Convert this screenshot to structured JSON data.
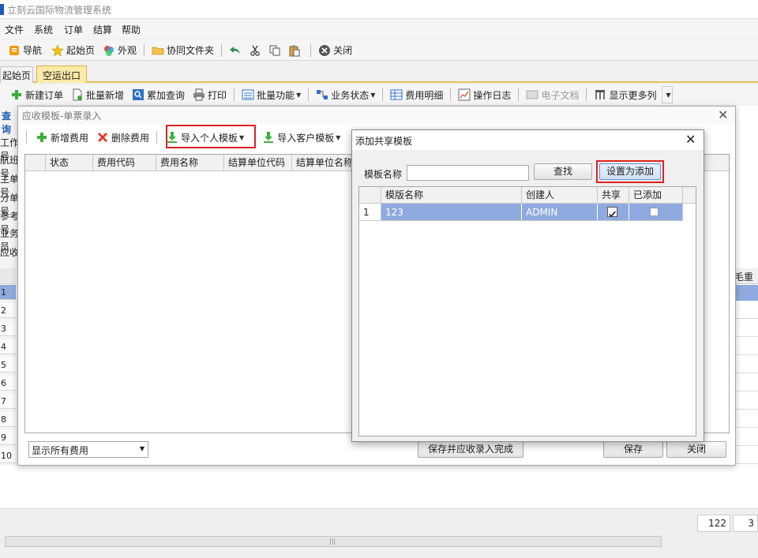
{
  "app": {
    "title": "立刻云国际物流管理系统"
  },
  "menubar": [
    "文件",
    "系统",
    "订单",
    "结算",
    "帮助"
  ],
  "main_toolbar": {
    "nav": "导航",
    "home": "起始页",
    "appearance": "外观",
    "shared_folder": "协同文件夹",
    "close": "关闭"
  },
  "doc_tabs": [
    "起始页",
    "空运出口"
  ],
  "order_toolbar": {
    "new_order": "新建订单",
    "batch_new": "批量新增",
    "cumulative_query": "累加查询",
    "print": "打印",
    "batch_func": "批量功能",
    "business_status": "业务状态",
    "fee_detail": "费用明细",
    "op_log": "操作日志",
    "e_docs": "电子文档",
    "show_more": "显示更多列"
  },
  "left_labels": [
    "查询",
    "工作号",
    "航班号",
    "主单号",
    "分单号",
    "参考号",
    "业务员",
    "应收"
  ],
  "bg_grid": {
    "col_header": "毛重",
    "rows": [
      "1",
      "2",
      "3",
      "4",
      "5",
      "6",
      "7",
      "8",
      "9",
      "10"
    ],
    "status_value": "122",
    "status_value2": "3"
  },
  "receivable_dialog": {
    "title": "应收模板-单票录入",
    "toolbar": {
      "add_fee": "新增费用",
      "delete_fee": "删除费用",
      "import_personal": "导入个人模板",
      "import_customer": "导入客户模板"
    },
    "columns": [
      "状态",
      "费用代码",
      "费用名称",
      "结算单位代码",
      "结算单位名称"
    ],
    "filter_select": "显示所有费用",
    "save_complete": "保存并应收录入完成",
    "save": "保存",
    "close": "关闭"
  },
  "share_dialog": {
    "title": "添加共享模板",
    "name_label": "模板名称",
    "name_value": "",
    "search": "查找",
    "set_add": "设置为添加",
    "columns": [
      "模版名称",
      "创建人",
      "共享",
      "已添加"
    ],
    "rows": [
      {
        "num": "1",
        "name": "123",
        "creator": "ADMIN",
        "shared": true,
        "added": false
      }
    ]
  }
}
